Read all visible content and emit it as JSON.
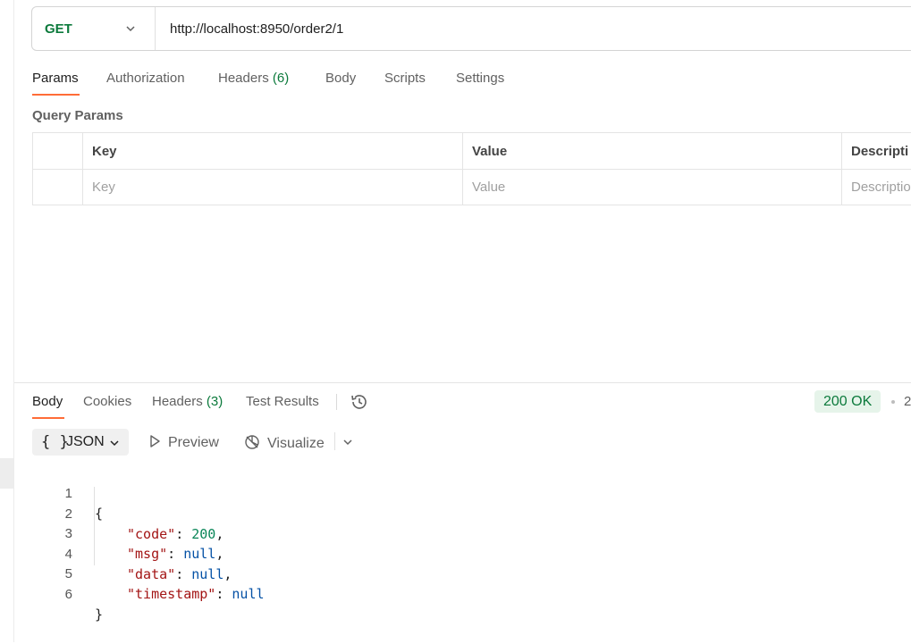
{
  "request": {
    "method": "GET",
    "url": "http://localhost:8950/order2/1"
  },
  "request_tabs": [
    {
      "label": "Params",
      "active": true
    },
    {
      "label": "Authorization"
    },
    {
      "label": "Headers",
      "count": "(6)"
    },
    {
      "label": "Body"
    },
    {
      "label": "Scripts"
    },
    {
      "label": "Settings"
    }
  ],
  "query_params": {
    "title": "Query Params",
    "headers": [
      "Key",
      "Value",
      "Descripti"
    ],
    "placeholders": [
      "Key",
      "Value",
      "Descriptio"
    ]
  },
  "response_tabs": [
    {
      "label": "Body",
      "active": true
    },
    {
      "label": "Cookies"
    },
    {
      "label": "Headers",
      "count": "(3)"
    },
    {
      "label": "Test Results"
    }
  ],
  "status": {
    "text": "200 OK",
    "truncated": "2",
    "color": "#0c7a3c"
  },
  "format_toolbar": {
    "format_icon": "{ }",
    "format_label": "JSON",
    "preview_label": "Preview",
    "visualize_label": "Visualize"
  },
  "response_body": {
    "line_numbers": [
      "1",
      "2",
      "3",
      "4",
      "5",
      "6"
    ],
    "open": "{",
    "close": "}",
    "fields": [
      {
        "key": "\"code\"",
        "value": "200",
        "type": "number",
        "comma": ","
      },
      {
        "key": "\"msg\"",
        "value": "null",
        "type": "null",
        "comma": ","
      },
      {
        "key": "\"data\"",
        "value": "null",
        "type": "null",
        "comma": ","
      },
      {
        "key": "\"timestamp\"",
        "value": "null",
        "type": "null",
        "comma": ""
      }
    ]
  },
  "colors": {
    "accent": "#ff6c37",
    "method": "#0c7a3c"
  },
  "icons": [
    "chevron-down-icon",
    "history-icon",
    "play-icon",
    "visualize-icon"
  ]
}
